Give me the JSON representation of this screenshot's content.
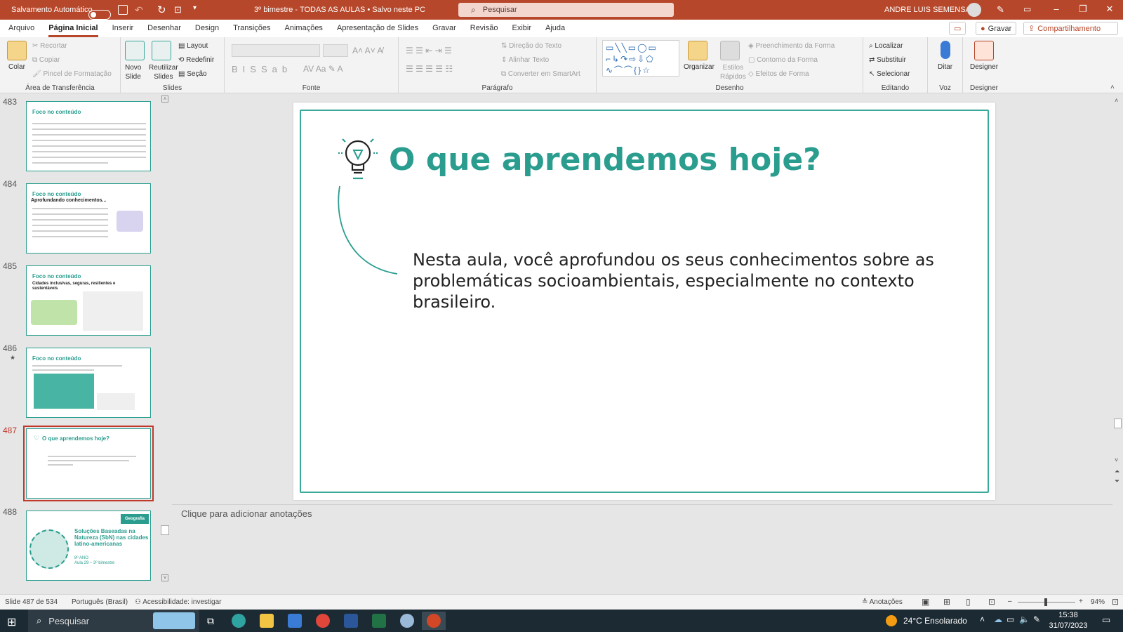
{
  "titlebar": {
    "autosave_label": "Salvamento Automático",
    "doc_title": "3º bimestre - TODAS AS AULAS  •  Salvo neste PC",
    "search_placeholder": "Pesquisar",
    "user_name": "ANDRE LUIS SEMENSATO",
    "accent_color": "#b7472a"
  },
  "menu": {
    "tabs": [
      "Arquivo",
      "Página Inicial",
      "Inserir",
      "Desenhar",
      "Design",
      "Transições",
      "Animações",
      "Apresentação de Slides",
      "Gravar",
      "Revisão",
      "Exibir",
      "Ajuda"
    ],
    "record_button": "Gravar",
    "share_button": "Compartilhamento"
  },
  "ribbon": {
    "clipboard": {
      "paste": "Colar",
      "cut": "Recortar",
      "copy": "Copiar",
      "painter": "Pincel de Formatação",
      "label": "Área de Transferência"
    },
    "slides": {
      "new_slide_1": "Novo",
      "new_slide_2": "Slide",
      "reuse_1": "Reutilizar",
      "reuse_2": "Slides",
      "layout": "Layout",
      "reset": "Redefinir",
      "section": "Seção",
      "label": "Slides"
    },
    "font": {
      "label": "Fonte"
    },
    "paragraph": {
      "text_direction": "Direção do Texto",
      "align_text": "Alinhar Texto",
      "smartart": "Converter em SmartArt",
      "label": "Parágrafo"
    },
    "drawing": {
      "arrange": "Organizar",
      "quick_styles_1": "Estilos",
      "quick_styles_2": "Rápidos",
      "fill": "Preenchimento da Forma",
      "outline": "Contorno da Forma",
      "effects": "Efeitos de Forma",
      "label": "Desenho"
    },
    "editing": {
      "find": "Localizar",
      "replace": "Substituir",
      "select": "Selecionar",
      "label": "Editando"
    },
    "voice": {
      "dictate": "Ditar",
      "label": "Voz"
    },
    "designer": {
      "button": "Designer",
      "label": "Designer"
    }
  },
  "thumbnails": [
    {
      "num": "483",
      "title": "Foco no conteúdo"
    },
    {
      "num": "484",
      "title": "Foco no conteúdo",
      "sub": "Aprofundando conhecimentos..."
    },
    {
      "num": "485",
      "title": "Foco no conteúdo",
      "sub": "Cidades inclusivas, seguras, resilientes e sustentáveis"
    },
    {
      "num": "486",
      "title": "Foco no conteúdo",
      "star": "★"
    },
    {
      "num": "487",
      "title": "O que aprendemos hoje?"
    },
    {
      "num": "488",
      "title": "Soluções Baseadas na Natureza (SbN) nas cidades latino-americanas",
      "tag": "Geografia",
      "grade": "8º ANO",
      "lesson": "Aula 29 – 3º bimestre"
    }
  ],
  "slide": {
    "title": "O que aprendemos hoje?",
    "body": "Nesta aula, você aprofundou os seus conhecimentos sobre as problemáticas socioambientais, especialmente no contexto brasileiro.",
    "theme_color": "#2a9d8f"
  },
  "notes_placeholder": "Clique para adicionar anotações",
  "statusbar": {
    "slide_counter": "Slide 487 de 534",
    "language": "Português (Brasil)",
    "accessibility": "Acessibilidade: investigar",
    "notes_button": "Anotações",
    "zoom": "94%"
  },
  "taskbar": {
    "search_placeholder": "Pesquisar",
    "weather": "24°C  Ensolarado",
    "time": "15:38",
    "date": "31/07/2023"
  }
}
